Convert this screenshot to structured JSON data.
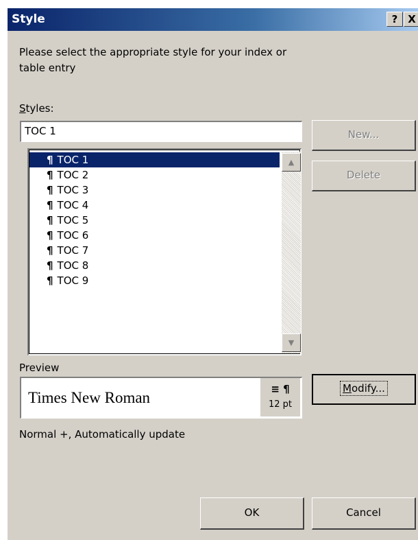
{
  "dialog": {
    "title": "Style",
    "help_label": "?",
    "close_label": "X"
  },
  "instructions": "Please select the appropriate style for your index or table entry",
  "styles": {
    "label_prefix": "S",
    "label_rest": "tyles:",
    "input_value": "TOC 1",
    "pilcrow": "¶",
    "items": [
      "TOC 1",
      "TOC 2",
      "TOC 3",
      "TOC 4",
      "TOC 5",
      "TOC 6",
      "TOC 7",
      "TOC 8",
      "TOC 9"
    ],
    "selected_index": 0
  },
  "buttons": {
    "new_label": "New...",
    "delete_label": "Delete",
    "modify_prefix": "M",
    "modify_rest": "odify...",
    "ok_label": "OK",
    "cancel_label": "Cancel"
  },
  "preview": {
    "label": "Preview",
    "font_name": "Times New Roman",
    "icons": "≡ ¶",
    "size": "12 pt"
  },
  "description": "Normal +, Automatically update",
  "scroll": {
    "up_icon": "▲",
    "down_icon": "▼"
  }
}
